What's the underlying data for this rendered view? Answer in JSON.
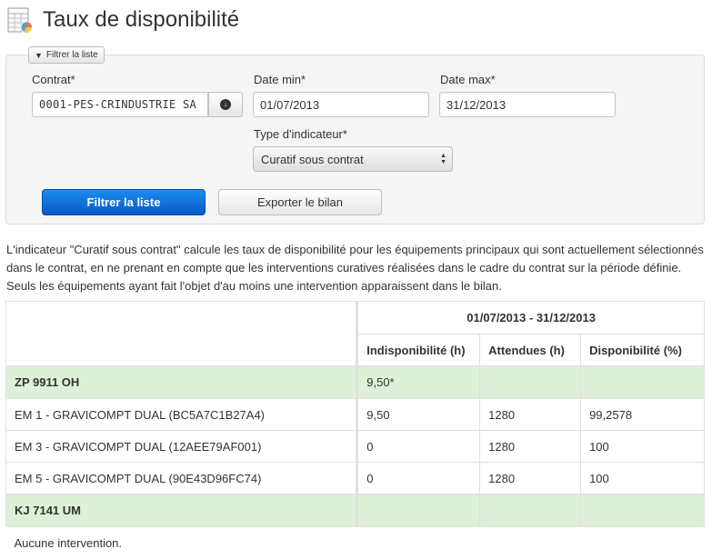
{
  "page": {
    "title": "Taux de disponibilité",
    "icon": "spreadsheet-icon"
  },
  "filter": {
    "tab_label": "Filtrer la liste",
    "contract_label": "Contrat*",
    "contract_value": "0001-PES-CRINDUSTRIE SA",
    "date_min_label": "Date min*",
    "date_min_value": "01/07/2013",
    "date_max_label": "Date max*",
    "date_max_value": "31/12/2013",
    "indicator_label": "Type d'indicateur*",
    "indicator_value": "Curatif sous contrat",
    "filter_button": "Filtrer la liste",
    "export_button": "Exporter le bilan"
  },
  "description": "L'indicateur \"Curatif sous contrat\" calcule les taux de disponibilité pour les équipements principaux qui sont actuellement sélectionnés dans le contrat, en ne prenant en compte que les interventions curatives réalisées dans le cadre du contrat sur la période définie. Seuls les équipements ayant fait l'objet d'au moins une intervention apparaissent dans le bilan.",
  "table": {
    "period": "01/07/2013 - 31/12/2013",
    "columns": [
      "Indisponibilité (h)",
      "Attendues (h)",
      "Disponibilité (%)"
    ],
    "groups": [
      {
        "name": "ZP 9911 OH",
        "total": "9,50*",
        "rows": [
          {
            "name": "EM 1 - GRAVICOMPT DUAL (BC5A7C1B27A4)",
            "indispo": "9,50",
            "attendues": "1280",
            "dispo": "99,2578"
          },
          {
            "name": "EM 3 - GRAVICOMPT DUAL (12AEE79AF001)",
            "indispo": "0",
            "attendues": "1280",
            "dispo": "100"
          },
          {
            "name": "EM 5 - GRAVICOMPT DUAL (90E43D96FC74)",
            "indispo": "0",
            "attendues": "1280",
            "dispo": "100"
          }
        ]
      },
      {
        "name": "KJ 7141 UM",
        "no_intervention": "Aucune intervention."
      }
    ]
  },
  "colors": {
    "primary": "#0a6fdc",
    "group_row": "#dff0d8"
  }
}
